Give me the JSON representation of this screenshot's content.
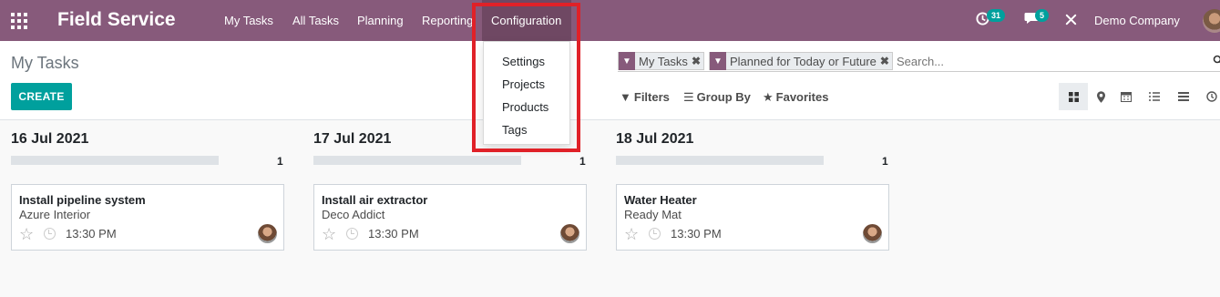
{
  "navbar": {
    "brand": "Field Service",
    "menu": [
      "My Tasks",
      "All Tasks",
      "Planning",
      "Reporting"
    ],
    "config_label": "Configuration",
    "activity_count": "31",
    "messages_count": "5",
    "company": "Demo Company"
  },
  "config_dropdown": {
    "items": [
      "Settings",
      "Projects",
      "Products",
      "Tags"
    ]
  },
  "control_panel": {
    "breadcrumb": "My Tasks",
    "create_label": "CREATE",
    "facets": [
      "My Tasks",
      "Planned for Today or Future"
    ],
    "search_placeholder": "Search...",
    "filters_label": "Filters",
    "groupby_label": "Group By",
    "favorites_label": "Favorites",
    "views": [
      "kanban-icon",
      "map-icon",
      "calendar-icon",
      "list-icon",
      "gantt-icon",
      "activity-icon"
    ]
  },
  "columns": [
    {
      "title": "16 Jul 2021",
      "count": "1",
      "card": {
        "title": "Install pipeline system",
        "customer": "Azure Interior",
        "time": "13:30 PM"
      }
    },
    {
      "title": "17 Jul 2021",
      "count": "1",
      "card": {
        "title": "Install air extractor",
        "customer": "Deco Addict",
        "time": "13:30 PM"
      }
    },
    {
      "title": "18 Jul 2021",
      "count": "1",
      "card": {
        "title": "Water Heater",
        "customer": "Ready Mat",
        "time": "13:30 PM"
      }
    }
  ],
  "colors": {
    "navbar": "#875a7b",
    "accent": "#00a09d",
    "highlight": "#e02128"
  }
}
